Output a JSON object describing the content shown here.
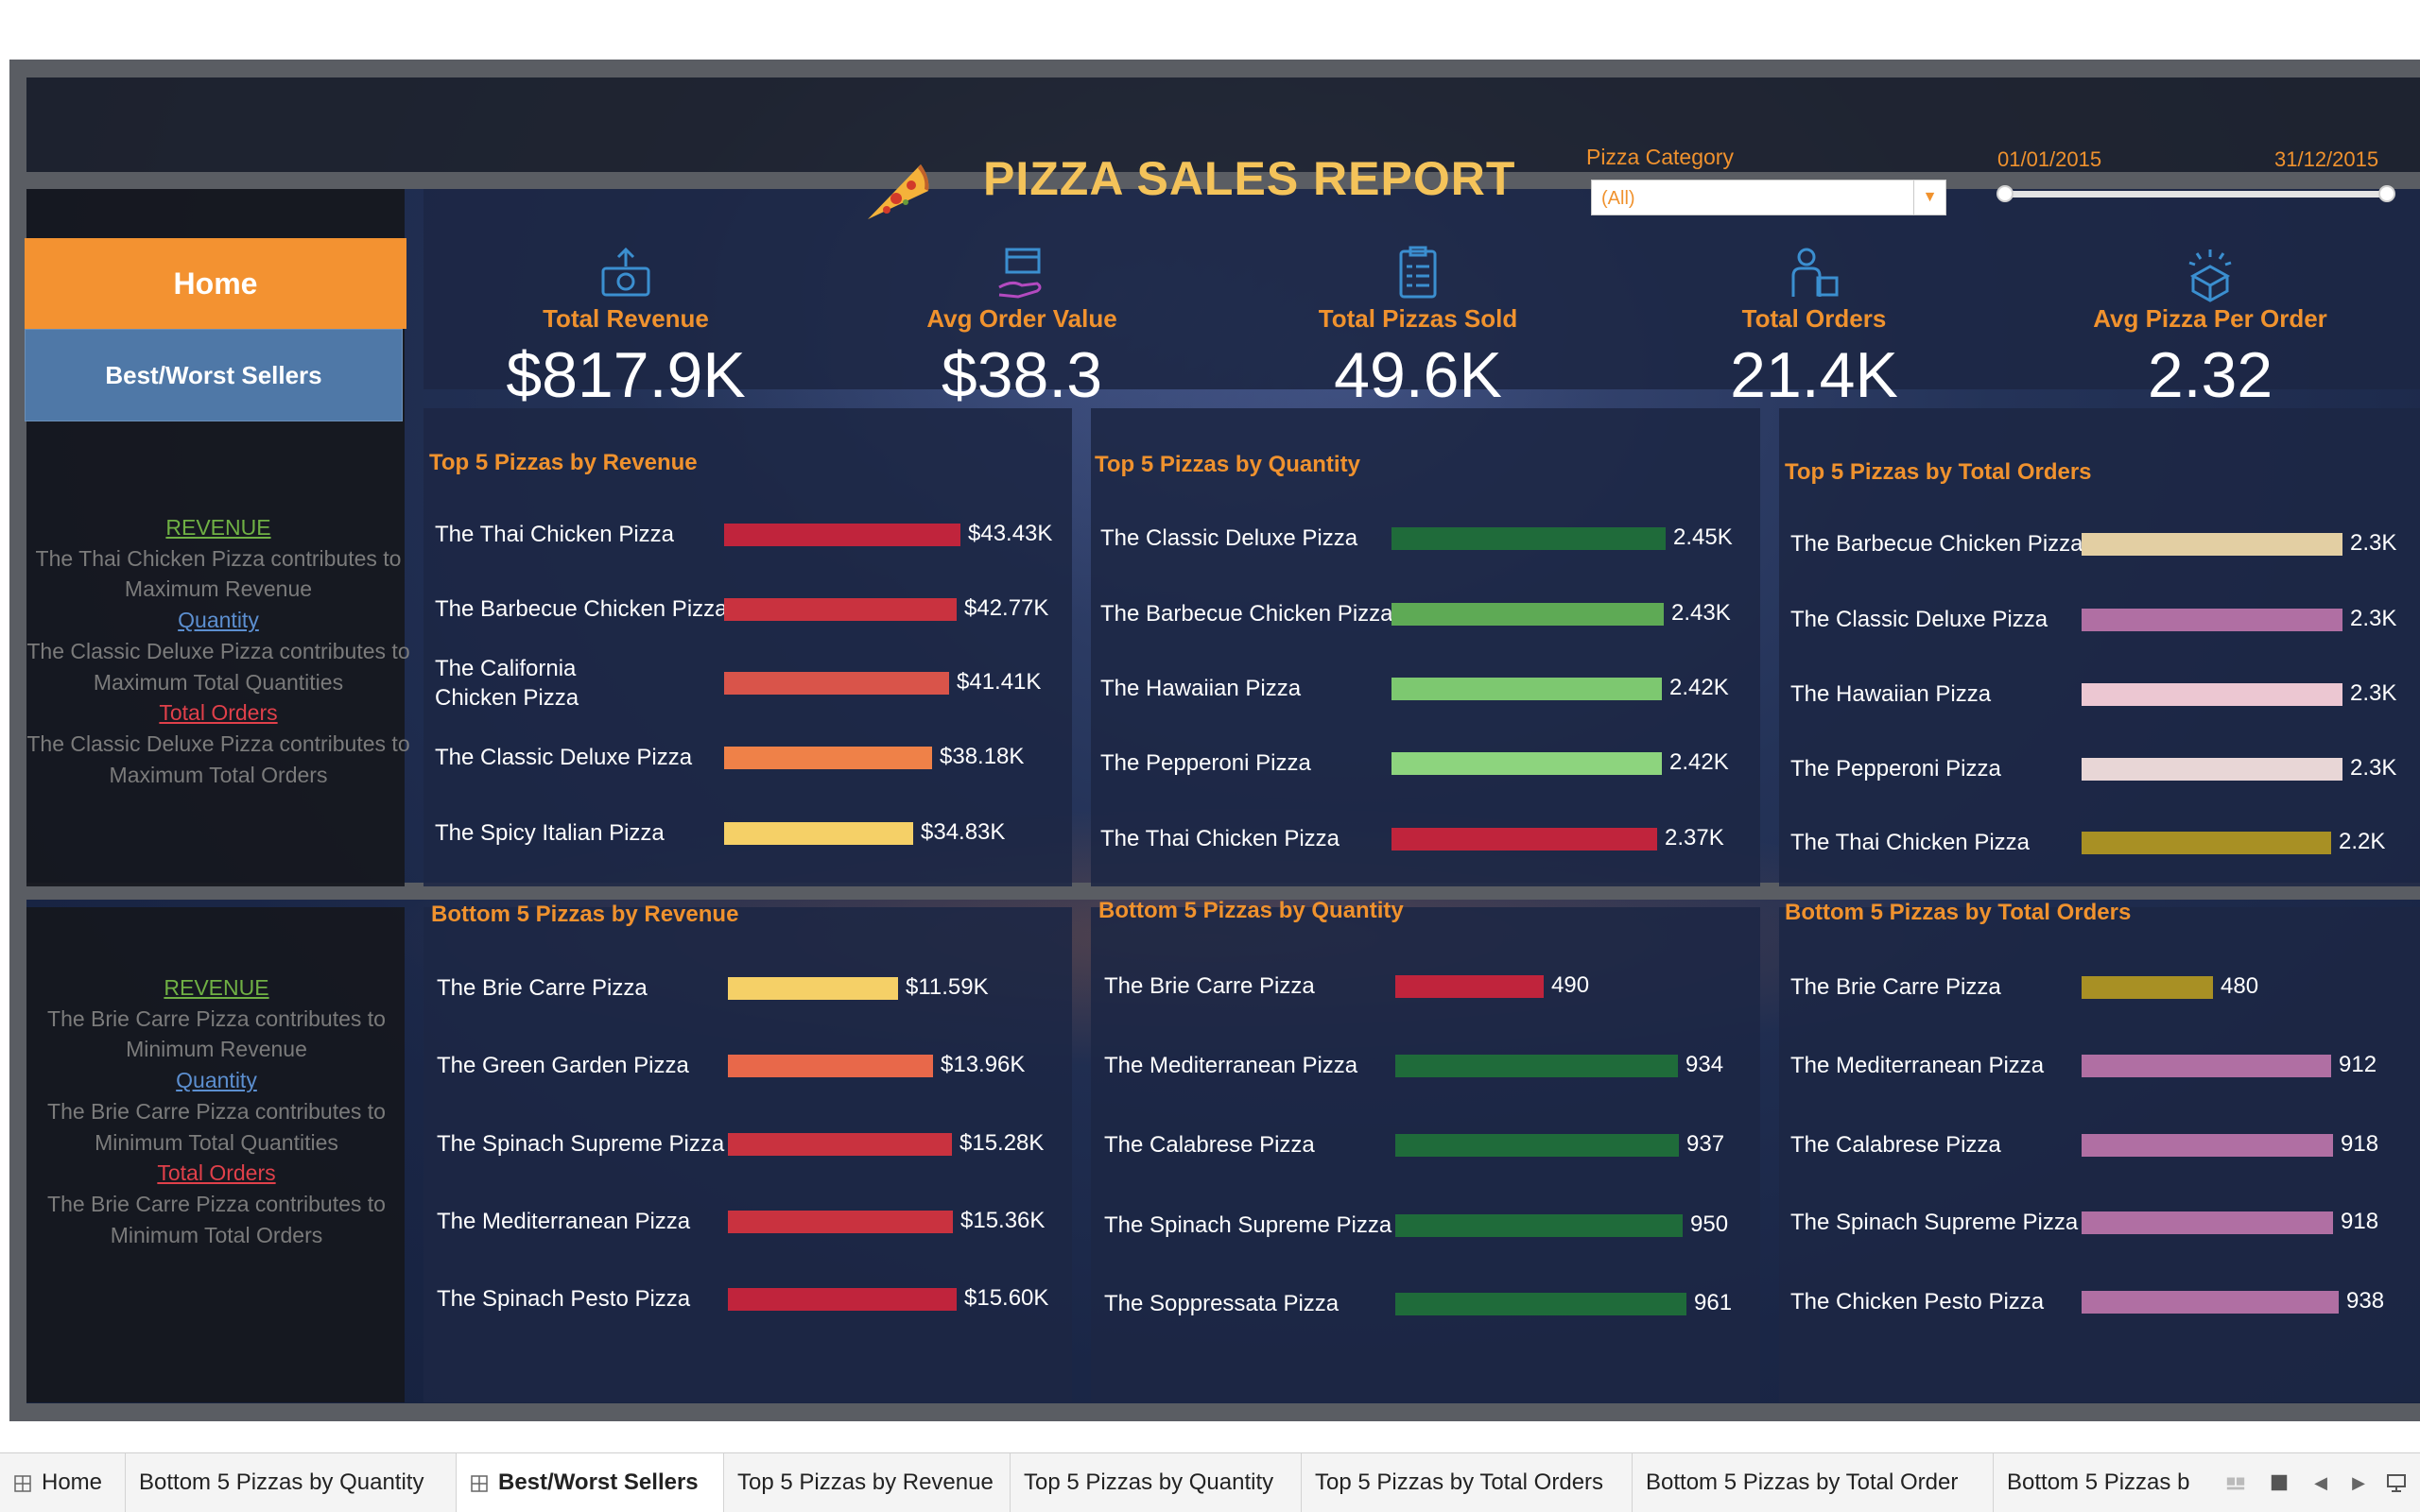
{
  "header": {
    "title": "PIZZA SALES REPORT"
  },
  "filters": {
    "category_label": "Pizza Category",
    "category_value": "(All)",
    "date_start": "01/01/2015",
    "date_end": "31/12/2015"
  },
  "kpis": [
    {
      "label": "Total Revenue",
      "value": "$817.9K",
      "icon": "money-icon"
    },
    {
      "label": "Avg Order Value",
      "value": "$38.3",
      "icon": "box-hand-icon"
    },
    {
      "label": "Total Pizzas Sold",
      "value": "49.6K",
      "icon": "clipboard-icon"
    },
    {
      "label": "Total Orders",
      "value": "21.4K",
      "icon": "delivery-icon"
    },
    {
      "label": "Avg Pizza Per Order",
      "value": "2.32",
      "icon": "badge-box-icon"
    }
  ],
  "nav": {
    "home": "Home",
    "best_worst": "Best/Worst Sellers"
  },
  "insights_top": {
    "rev_h": "REVENUE",
    "rev_t": "The Thai Chicken Pizza contributes to Maximum Revenue",
    "qty_h": "Quantity",
    "qty_t": "The Classic Deluxe Pizza contributes to Maximum Total Quantities",
    "ord_h": "Total Orders",
    "ord_t": "The Classic Deluxe Pizza contributes to Maximum Total Orders"
  },
  "insights_bottom": {
    "rev_h": "REVENUE",
    "rev_t": "The Brie Carre Pizza contributes to Minimum Revenue",
    "qty_h": "Quantity",
    "qty_t": "The Brie Carre Pizza contributes to Minimum Total Quantities",
    "ord_h": "Total Orders",
    "ord_t": "The Brie Carre Pizza contributes to Minimum Total Orders"
  },
  "chart_data": [
    {
      "type": "bar",
      "title": "Top 5 Pizzas by Revenue",
      "categories": [
        "The Thai Chicken Pizza",
        "The Barbecue Chicken Pizza",
        "The California Chicken Pizza",
        "The Classic Deluxe Pizza",
        "The Spicy Italian Pizza"
      ],
      "values": [
        43.43,
        42.77,
        41.41,
        38.18,
        34.83
      ],
      "labels": [
        "$43.43K",
        "$42.77K",
        "$41.41K",
        "$38.18K",
        "$34.83K"
      ],
      "colors": [
        "#c0243c",
        "#c9323f",
        "#d9544a",
        "#ef8148",
        "#f5d067"
      ]
    },
    {
      "type": "bar",
      "title": "Top 5 Pizzas by Quantity",
      "categories": [
        "The Classic Deluxe Pizza",
        "The Barbecue Chicken Pizza",
        "The Hawaiian Pizza",
        "The Pepperoni Pizza",
        "The Thai Chicken Pizza"
      ],
      "values": [
        2.45,
        2.43,
        2.42,
        2.42,
        2.37
      ],
      "labels": [
        "2.45K",
        "2.43K",
        "2.42K",
        "2.42K",
        "2.37K"
      ],
      "colors": [
        "#1f6b3a",
        "#5eaa55",
        "#7dc870",
        "#8dd47e",
        "#c0243c"
      ]
    },
    {
      "type": "bar",
      "title": "Top 5 Pizzas by Total Orders",
      "categories": [
        "The Barbecue Chicken Pizza",
        "The Classic Deluxe Pizza",
        "The Hawaiian Pizza",
        "The Pepperoni Pizza",
        "The Thai Chicken Pizza"
      ],
      "values": [
        2.3,
        2.3,
        2.3,
        2.3,
        2.2
      ],
      "labels": [
        "2.3K",
        "2.3K",
        "2.3K",
        "2.3K",
        "2.2K"
      ],
      "colors": [
        "#e3cfa3",
        "#b06fa3",
        "#ecc7d2",
        "#e8d6d6",
        "#a89024"
      ]
    },
    {
      "type": "bar",
      "title": "Bottom 5 Pizzas by Revenue",
      "categories": [
        "The Brie Carre Pizza",
        "The Green Garden Pizza",
        "The Spinach Supreme Pizza",
        "The Mediterranean Pizza",
        "The Spinach Pesto Pizza"
      ],
      "values": [
        11.59,
        13.96,
        15.28,
        15.36,
        15.6
      ],
      "labels": [
        "$11.59K",
        "$13.96K",
        "$15.28K",
        "$15.36K",
        "$15.60K"
      ],
      "colors": [
        "#f5d067",
        "#e8684a",
        "#c9323f",
        "#c9323f",
        "#c0243c"
      ]
    },
    {
      "type": "bar",
      "title": "Bottom 5 Pizzas by Quantity",
      "categories": [
        "The Brie Carre Pizza",
        "The Mediterranean Pizza",
        "The Calabrese Pizza",
        "The Spinach Supreme Pizza",
        "The Soppressata Pizza"
      ],
      "values": [
        490,
        934,
        937,
        950,
        961
      ],
      "labels": [
        "490",
        "934",
        "937",
        "950",
        "961"
      ],
      "colors": [
        "#c0243c",
        "#1f6b3a",
        "#1f6b3a",
        "#1f6b3a",
        "#1f6b3a"
      ]
    },
    {
      "type": "bar",
      "title": "Bottom 5 Pizzas by Total Orders",
      "categories": [
        "The Brie Carre Pizza",
        "The Mediterranean Pizza",
        "The Calabrese Pizza",
        "The Spinach Supreme Pizza",
        "The Chicken Pesto Pizza"
      ],
      "values": [
        480,
        912,
        918,
        918,
        938
      ],
      "labels": [
        "480",
        "912",
        "918",
        "918",
        "938"
      ],
      "colors": [
        "#a89024",
        "#b06fa3",
        "#b06fa3",
        "#b06fa3",
        "#b06fa3"
      ]
    }
  ],
  "tabs": [
    "Home",
    "Bottom 5 Pizzas by Quantity",
    "Best/Worst Sellers",
    "Top 5 Pizzas by Revenue",
    "Top 5 Pizzas by Quantity",
    "Top 5 Pizzas by Total Orders",
    "Bottom 5 Pizzas by Total Order",
    "Bottom 5 Pizzas b"
  ]
}
